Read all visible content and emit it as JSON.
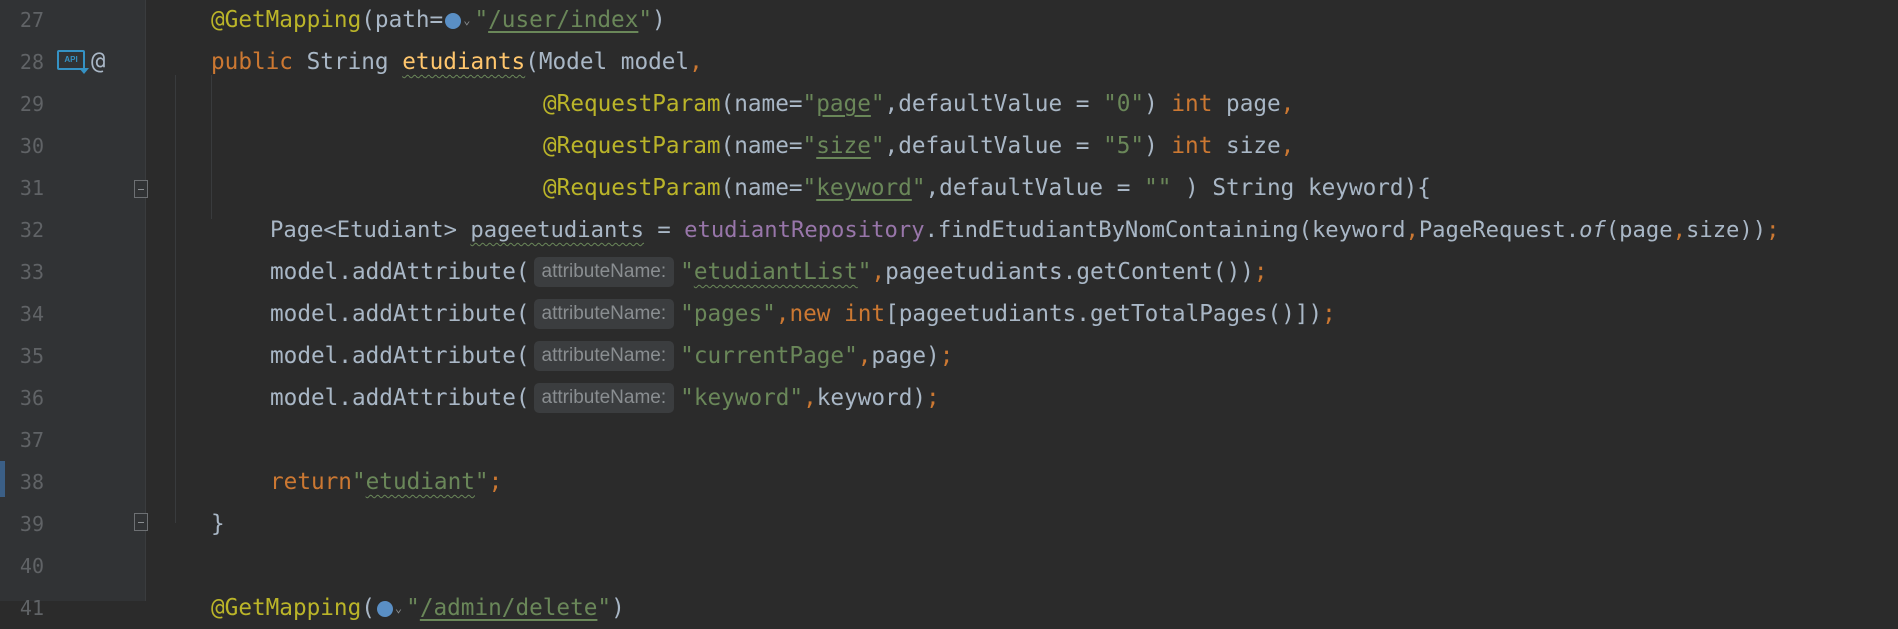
{
  "editor": {
    "line_numbers": [
      "27",
      "28",
      "29",
      "30",
      "31",
      "32",
      "33",
      "34",
      "35",
      "36",
      "37",
      "38",
      "39",
      "40",
      "41"
    ],
    "icons": {
      "api": "API",
      "annotation": "@"
    },
    "lines": {
      "l27": {
        "ann": "@GetMapping",
        "a": "(path=",
        "q1": "\"",
        "url": "/user/index",
        "q2": "\"",
        "b": ")"
      },
      "l28": {
        "kw": "public",
        "a": " String ",
        "fn": "etudiants",
        "b": "(Model model",
        "c": ","
      },
      "l29": {
        "ann": "@RequestParam",
        "a": "(name=",
        "q1": "\"",
        "v": "page",
        "q2": "\"",
        "b": ",defaultValue = ",
        "s": "\"0\"",
        "c": ") ",
        "kw": "int",
        "d": " page",
        "e": ","
      },
      "l30": {
        "ann": "@RequestParam",
        "a": "(name=",
        "q1": "\"",
        "v": "size",
        "q2": "\"",
        "b": ",defaultValue = ",
        "s": "\"5\"",
        "c": ") ",
        "kw": "int",
        "d": " size",
        "e": ","
      },
      "l31": {
        "ann": "@RequestParam",
        "a": "(name=",
        "q1": "\"",
        "v": "keyword",
        "q2": "\"",
        "b": ",defaultValue = ",
        "s": "\"\"",
        "c": " ) String keyword){"
      },
      "l32": {
        "a": "Page<Etudiant> ",
        "v": "pageetudiants",
        "b": " = ",
        "fld": "etudiantRepository",
        "c": ".findEtudiantByNomContaining(keyword",
        "k1": ",",
        "d": "PageRequest.",
        "it": "of",
        "e": "(page",
        "k2": ",",
        "f": "size))",
        "k3": ";"
      },
      "l33": {
        "a": "model.addAttribute(",
        "hint": "attributeName:",
        "q1": "\"",
        "s": "etudiantList",
        "q2": "\"",
        "k1": ",",
        "b": "pageetudiants.getContent())",
        "k2": ";"
      },
      "l34": {
        "a": "model.addAttribute(",
        "hint": "attributeName:",
        "s": "\"pages\"",
        "k1": ",",
        "kw1": "new ",
        "kw2": "int",
        "b": "[pageetudiants.getTotalPages()])",
        "k2": ";"
      },
      "l35": {
        "a": "model.addAttribute(",
        "hint": "attributeName:",
        "s": "\"currentPage\"",
        "k1": ",",
        "b": "page)",
        "k2": ";"
      },
      "l36": {
        "a": "model.addAttribute(",
        "hint": "attributeName:",
        "s": "\"keyword\"",
        "k1": ",",
        "b": "keyword)",
        "k2": ";"
      },
      "l38": {
        "kw": "return",
        "q1": "\"",
        "s": "etudiant",
        "q2": "\"",
        "k": ";"
      },
      "l39": {
        "a": "}"
      },
      "l41": {
        "ann": "@GetMapping",
        "a": "(",
        "q1": "\"",
        "url": "/admin/delete",
        "q2": "\"",
        "b": ")"
      }
    }
  }
}
